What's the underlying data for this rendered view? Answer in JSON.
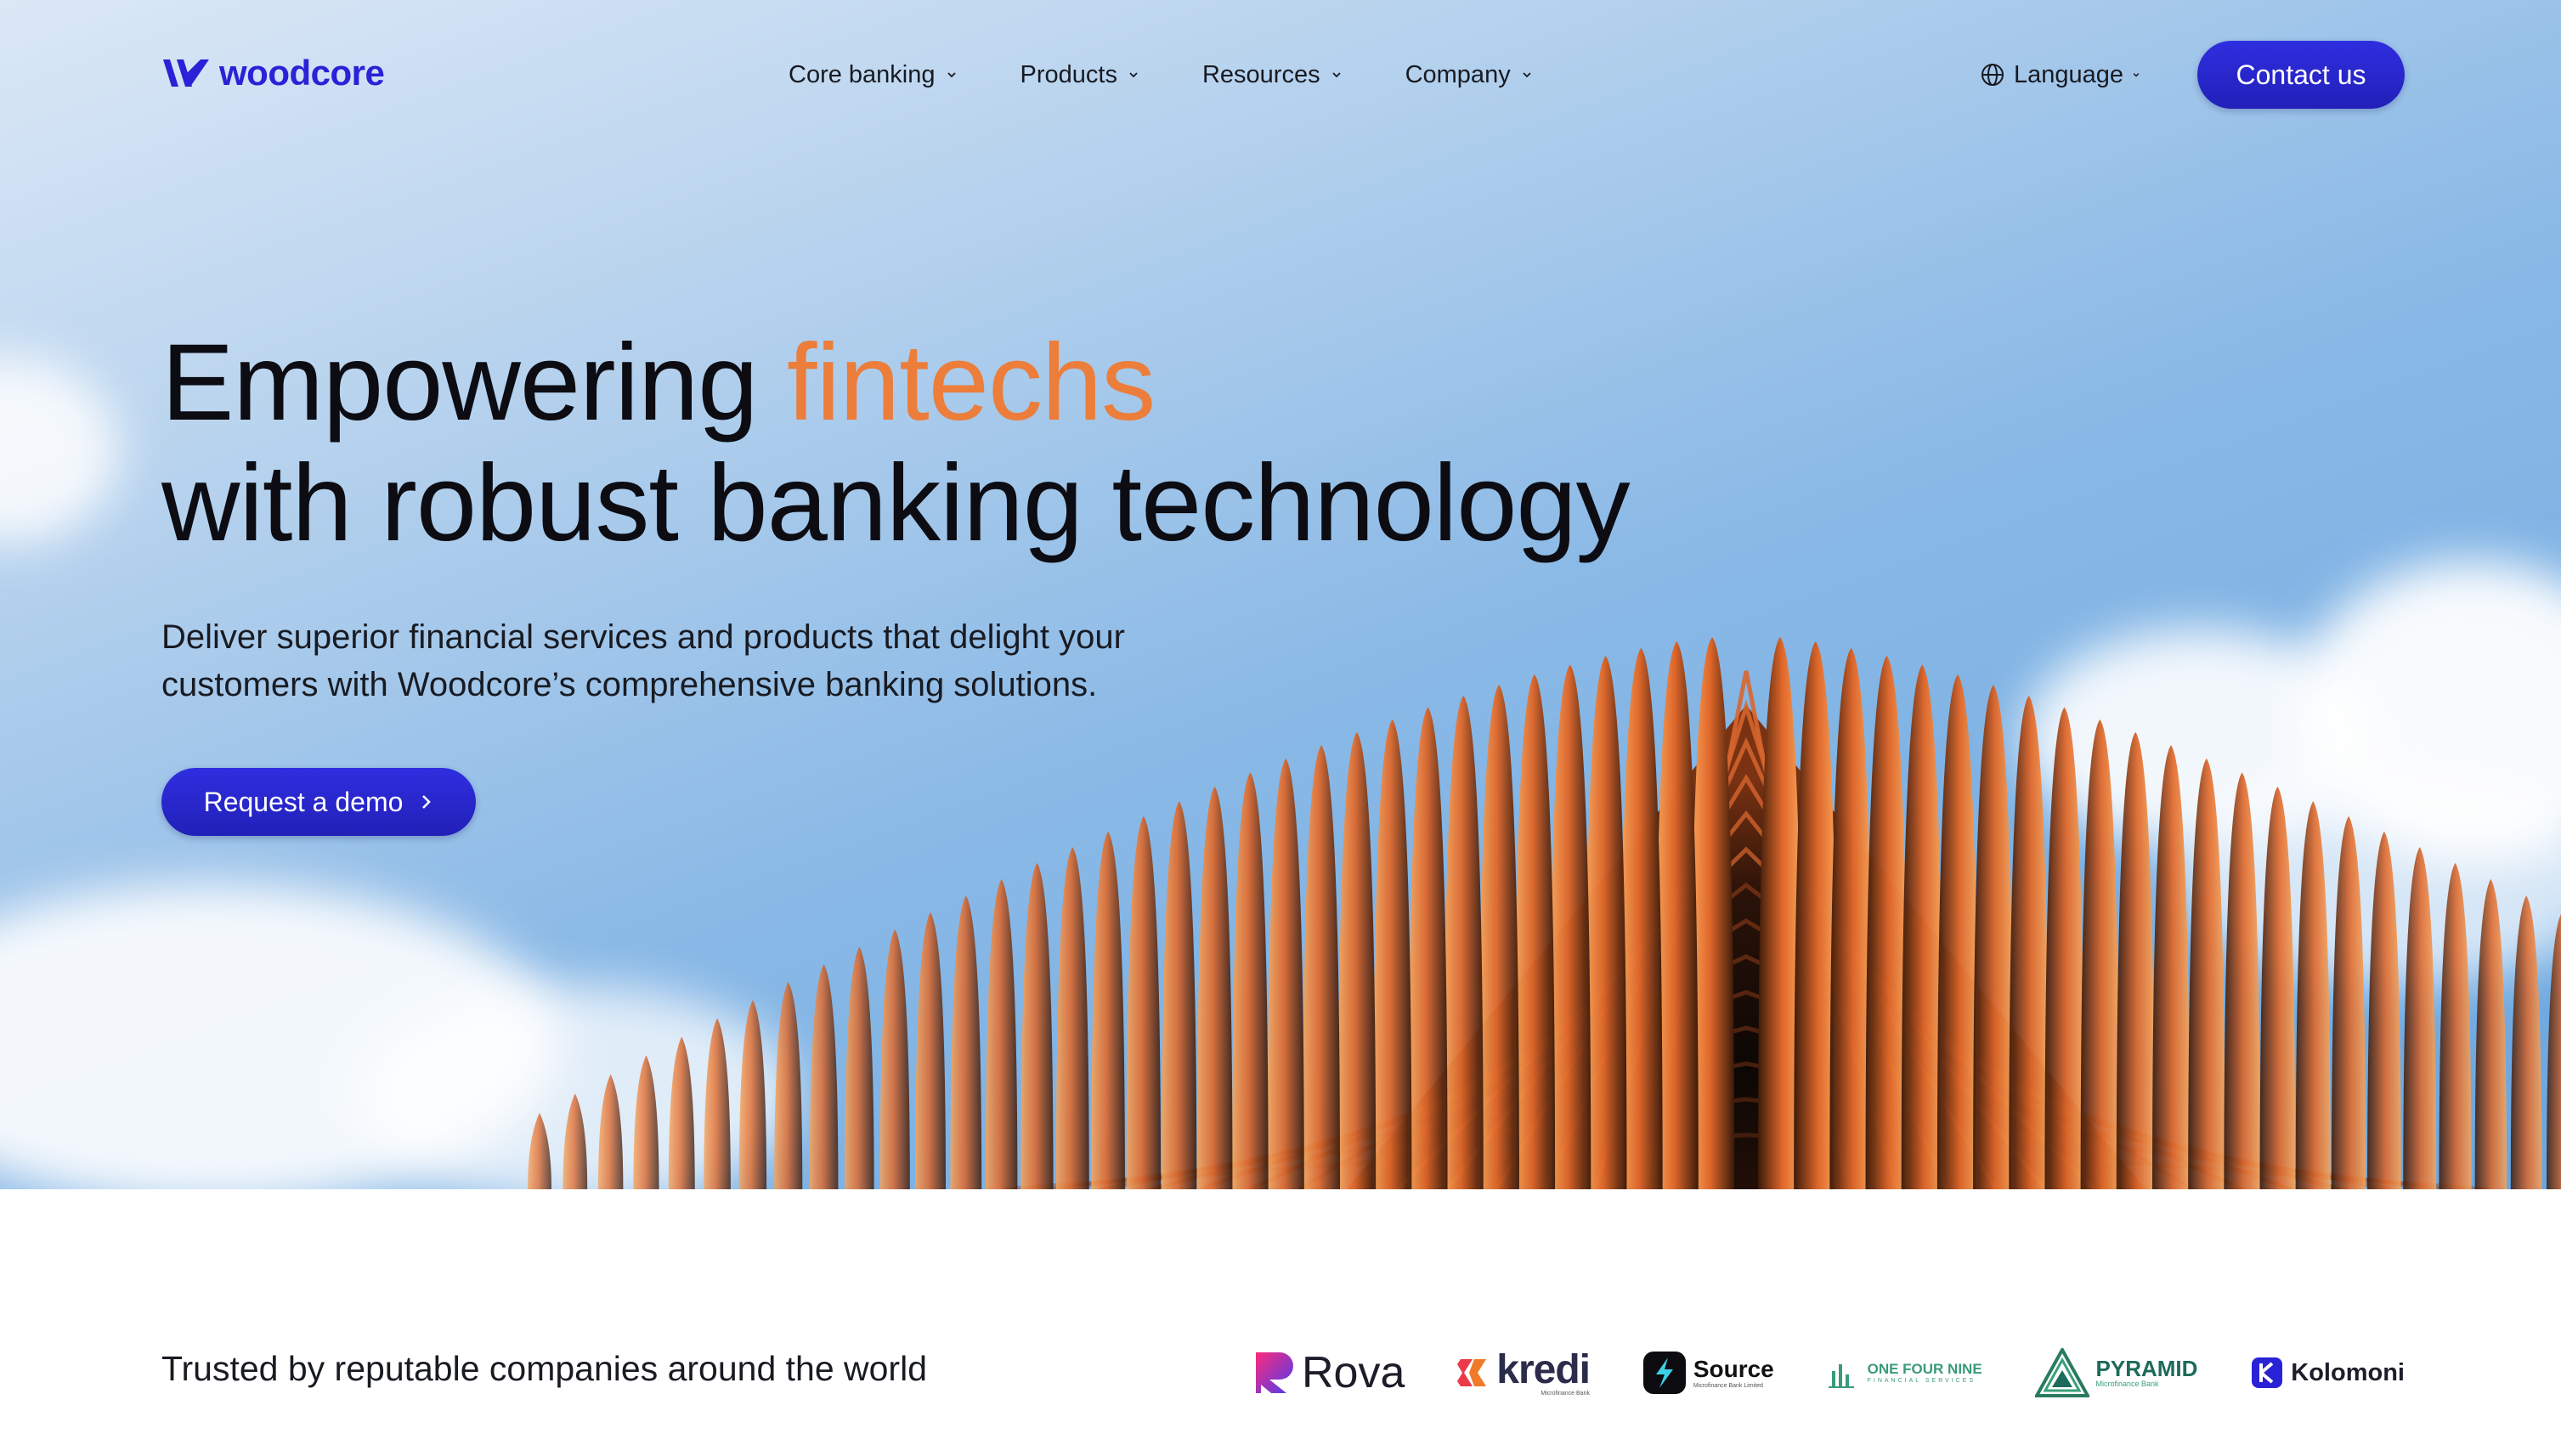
{
  "brand": {
    "name": "woodcore",
    "color": "#2a22d6"
  },
  "nav": {
    "items": [
      {
        "label": "Core banking"
      },
      {
        "label": "Products"
      },
      {
        "label": "Resources"
      },
      {
        "label": "Company"
      }
    ],
    "language": "Language",
    "contact": "Contact us"
  },
  "hero": {
    "headline_start": "Empowering ",
    "headline_accent": "fintechs",
    "headline_end": "with robust banking technology",
    "subhead": "Deliver superior financial services and products that delight your customers with Woodcore’s comprehensive banking solutions.",
    "cta": "Request a demo",
    "accent_color": "#ec7d3a",
    "button_color": "#2a27d2"
  },
  "trust": {
    "heading": "Trusted by reputable companies around the world",
    "logos": [
      {
        "name": "Rova"
      },
      {
        "name": "kredi",
        "sub": "Microfinance Bank"
      },
      {
        "name": "Source",
        "sub": "Microfinance Bank Limited"
      },
      {
        "name": "ONE FOUR NINE",
        "sub": "FINANCIAL SERVICES"
      },
      {
        "name": "PYRAMID",
        "sub": "Microfinance Bank"
      },
      {
        "name": "Kolomoni"
      }
    ]
  }
}
